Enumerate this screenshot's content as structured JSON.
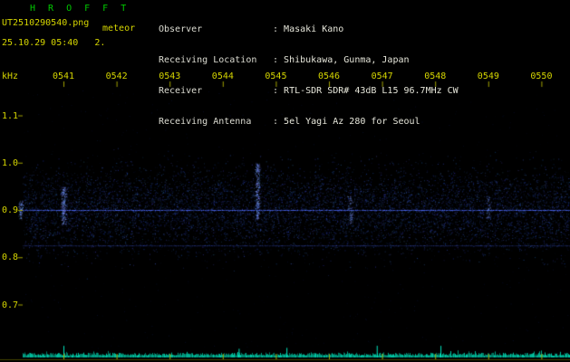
{
  "header": {
    "app_title": "H R O F F T",
    "filename": "UT2510290540.png",
    "station": "meteor",
    "datetime_line": "25.10.29 05:40   2.",
    "sep": ": ",
    "info": [
      {
        "label": "Observer",
        "value": "Masaki Kano"
      },
      {
        "label": "Receiving Location",
        "value": "Shibukawa, Gunma, Japan"
      },
      {
        "label": "Receiver",
        "value": "RTL-SDR SDR# 43dB L15 96.7MHz CW"
      },
      {
        "label": "Receiving Antenna",
        "value": "5el Yagi Az 280 for Seoul"
      }
    ]
  },
  "chart_data": {
    "type": "heatmap",
    "title": "HROFFT 10-minute meteor radio spectrogram",
    "ylabel": "kHz",
    "x_ticks": [
      "0541",
      "0542",
      "0543",
      "0544",
      "0545",
      "0546",
      "0547",
      "0548",
      "0549",
      "0550"
    ],
    "y_ticks": [
      "1.1",
      "1.0",
      "0.9",
      "0.8",
      "0.7"
    ],
    "y_range_khz": [
      0.65,
      1.15
    ],
    "grid": false,
    "legend": "none",
    "noise_band": {
      "center_khz": 0.9,
      "spread_khz": 0.05
    },
    "carrier_lines": [
      {
        "freq_khz": 0.9,
        "intensity": "strong"
      },
      {
        "freq_khz": 0.825,
        "intensity": "medium"
      }
    ],
    "echo_events": [
      {
        "t_min": 0.2,
        "f_low": 0.88,
        "f_high": 0.92,
        "intensity": 0.9
      },
      {
        "t_min": 1.0,
        "f_low": 0.87,
        "f_high": 0.95,
        "intensity": 1.0
      },
      {
        "t_min": 4.65,
        "f_low": 0.88,
        "f_high": 1.0,
        "intensity": 0.9
      },
      {
        "t_min": 6.4,
        "f_low": 0.87,
        "f_high": 0.93,
        "intensity": 0.7
      },
      {
        "t_min": 9.0,
        "f_low": 0.88,
        "f_high": 0.93,
        "intensity": 0.6
      }
    ],
    "bottom_trace": {
      "description": "signal-level trace: flat noise floor with small spikes",
      "spikes_t_min": [
        1.0,
        4.3,
        5.2,
        6.9,
        8.1
      ]
    },
    "palette": {
      "noise_blue": "#2a3faa",
      "carrier_blue": "#4d6aff",
      "trace_cyan": "#00dcb4",
      "axis_yellow": "#c8c800"
    }
  }
}
